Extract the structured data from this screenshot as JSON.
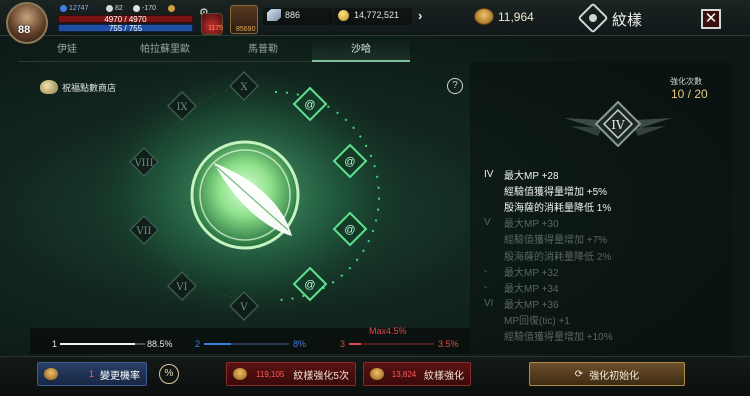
{
  "player": {
    "level": "88",
    "stat_a": "12747",
    "stat_b": "82",
    "stat_c": "-170",
    "stat_d": "",
    "hp": "4970 / 4970",
    "mp": "755 / 755",
    "potion_count": "1175",
    "item_count": "85690"
  },
  "currency": {
    "gems": "886",
    "gold": "14,772,521",
    "emblem_points": "11,964"
  },
  "header": {
    "title": "紋樣",
    "close": "✕"
  },
  "tabs": [
    {
      "label": "伊娃",
      "active": false
    },
    {
      "label": "帕拉蘇里歐",
      "active": false
    },
    {
      "label": "馬普勒",
      "active": false
    },
    {
      "label": "沙哈",
      "active": true
    }
  ],
  "shop": {
    "label": "祝福點數商店"
  },
  "help": {
    "label": "?"
  },
  "nodes": {
    "roman": [
      "X",
      "IX",
      "VIII",
      "VII",
      "VI",
      "V"
    ]
  },
  "enhance": {
    "count_label": "強化次數",
    "count_value": "10 / 20",
    "rank": "IV"
  },
  "stats": [
    {
      "rank": "IV",
      "text": "最大MP +28",
      "style": "b"
    },
    {
      "rank": "",
      "text": "經驗值獲得量增加 +5%",
      "style": "b"
    },
    {
      "rank": "",
      "text": "殷海薩的消耗量降低 1%",
      "style": "b"
    },
    {
      "rank": "V",
      "text": "最大MP +30",
      "style": "d"
    },
    {
      "rank": "",
      "text": "經驗值獲得量增加 +7%",
      "style": "d"
    },
    {
      "rank": "",
      "text": "殷海薩的消耗量降低 2%",
      "style": "d"
    },
    {
      "rank": "-",
      "text": "最大MP +32",
      "style": "d"
    },
    {
      "rank": "-",
      "text": "最大MP +34",
      "style": "d"
    },
    {
      "rank": "VI",
      "text": "最大MP +36",
      "style": "d"
    },
    {
      "rank": "",
      "text": "MP回復(tic) +1",
      "style": "d"
    },
    {
      "rank": "",
      "text": "經驗值獲得量增加 +10%",
      "style": "d"
    }
  ],
  "probabilities": {
    "p1_label": "1",
    "p1_value": "88.5%",
    "p1_fraction": 0.885,
    "p2_label": "2",
    "p2_value": "8%",
    "p2_fraction": 0.08,
    "p3_label": "3",
    "p3_value": "3.5%",
    "p3_fraction": 0.035,
    "max_label": "Max4.5%"
  },
  "buttons": {
    "change_count": "1",
    "change_label": "變更機率",
    "pct": "%",
    "enhance5_cost": "119,105",
    "enhance5_label": "紋樣強化5次",
    "enhance_cost": "13,824",
    "enhance_label": "紋樣強化",
    "reset_label": "強化初始化"
  },
  "colors": {
    "accent_green": "#5fe08f",
    "gold": "#e8c986",
    "red": "#e0484c",
    "blue": "#3d7ee0"
  }
}
